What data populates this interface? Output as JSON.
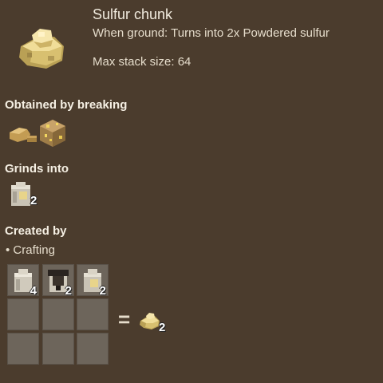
{
  "item": {
    "title": "Sulfur chunk",
    "description": "When ground: Turns into 2x Powdered sulfur",
    "max_stack": "Max stack size: 64",
    "icon": "sulfur-chunk-icon"
  },
  "sections": {
    "obtained_heading": "Obtained by breaking",
    "grinds_heading": "Grinds into",
    "created_heading": "Created by",
    "method": "• Crafting"
  },
  "obtained": [
    {
      "icon": "sulfur-slab-icon"
    },
    {
      "icon": "sulfur-ore-block-icon"
    }
  ],
  "grinds": {
    "icon": "powdered-sulfur-bag-icon",
    "count": "2"
  },
  "crafting": {
    "grid": [
      {
        "icon": "sack-icon",
        "count": "4"
      },
      {
        "icon": "charcoal-sack-icon",
        "count": "2"
      },
      {
        "icon": "powdered-sulfur-bag-icon",
        "count": "2"
      }
    ],
    "equals": "=",
    "output": {
      "icon": "sulfur-chunk-icon",
      "count": "2"
    }
  },
  "colors": {
    "background": "#4b3c2d",
    "slot": "#6d655b",
    "sulfur": "#e8d48a"
  }
}
